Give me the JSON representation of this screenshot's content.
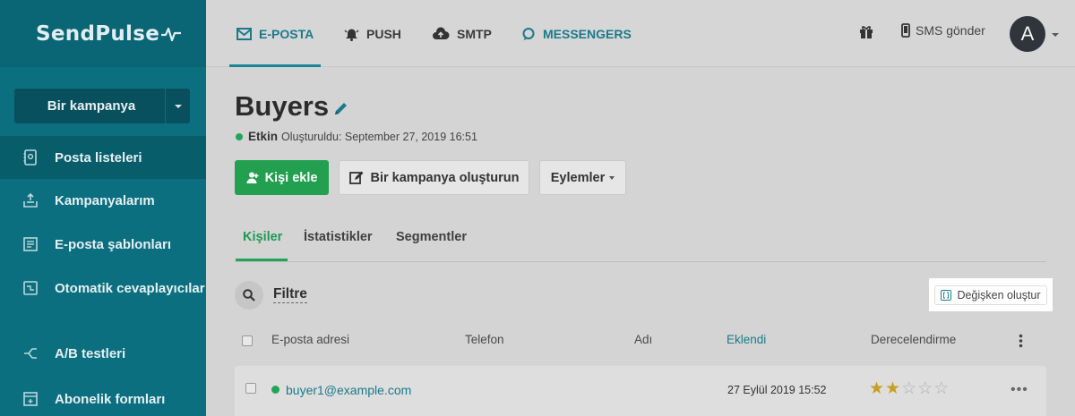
{
  "app": {
    "logo": "SendPulse"
  },
  "sidebar": {
    "campaign_button": "Bir kampanya",
    "items": [
      {
        "label": "Posta listeleri",
        "icon": "address-book-icon",
        "active": true
      },
      {
        "label": "Kampanyalarım",
        "icon": "outbox-icon"
      },
      {
        "label": "E-posta şablonları",
        "icon": "template-icon"
      },
      {
        "label": "Otomatik cevaplayıcılar",
        "icon": "automation-icon"
      },
      {
        "label": "A/B testleri",
        "icon": "split-test-icon"
      },
      {
        "label": "Abonelik formları",
        "icon": "form-icon"
      }
    ]
  },
  "topbar": {
    "tabs": [
      {
        "label": "E-POSTA",
        "icon": "envelope-icon",
        "active": true
      },
      {
        "label": "PUSH",
        "icon": "bell-icon"
      },
      {
        "label": "SMTP",
        "icon": "cloud-upload-icon"
      },
      {
        "label": "MESSENGERS",
        "icon": "chat-icon"
      }
    ],
    "sms_label": "SMS gönder",
    "avatar_letter": "A"
  },
  "list": {
    "title": "Buyers",
    "status": "Etkin",
    "created": "Oluşturuldu: September 27, 2019 16:51"
  },
  "actions": {
    "add_contact": "Kişi ekle",
    "create_campaign": "Bir kampanya oluşturun",
    "actions": "Eylemler"
  },
  "tabs": [
    "Kişiler",
    "İstatistikler",
    "Segmentler"
  ],
  "filter_label": "Filtre",
  "variable_button": "Değişken oluştur",
  "table": {
    "headers": [
      "E-posta adresi",
      "Telefon",
      "Adı",
      "Eklendi",
      "Derecelendirme"
    ],
    "rows": [
      {
        "email": "buyer1@example.com",
        "added": "27 Eylül 2019 15:52",
        "rating": 2,
        "rating_max": 5
      }
    ]
  },
  "colors": {
    "accent": "#1a7a8a",
    "success": "#22a04f",
    "sidebar": "#0b6f80"
  }
}
